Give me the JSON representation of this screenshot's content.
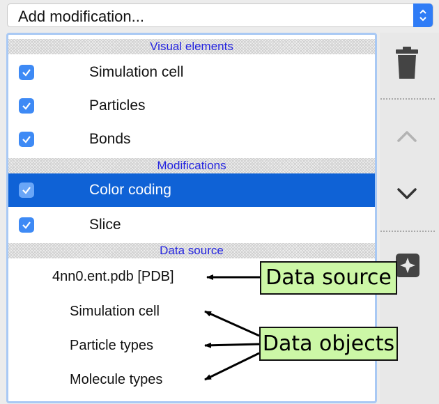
{
  "combo": {
    "value": "Add modification..."
  },
  "pipeline": {
    "sections": {
      "visual": "Visual elements",
      "modifications": "Modifications",
      "source": "Data source"
    },
    "visual_items": [
      {
        "label": "Simulation cell",
        "checked": true
      },
      {
        "label": "Particles",
        "checked": true
      },
      {
        "label": "Bonds",
        "checked": true
      }
    ],
    "modification_items": [
      {
        "label": "Color coding",
        "checked": true,
        "selected": true
      },
      {
        "label": "Slice",
        "checked": true,
        "selected": false
      }
    ],
    "source_items": [
      "4nn0.ent.pdb [PDB]",
      "Simulation cell",
      "Particle types",
      "Molecule types"
    ]
  },
  "toolbar": {
    "icons": [
      "trash-icon",
      "chevron-up-icon",
      "chevron-down-icon",
      "sparkle-icon"
    ]
  },
  "annotations": {
    "data_source": "Data source",
    "data_objects": "Data objects",
    "fill_color": "#ccf7a6"
  },
  "colors": {
    "selection": "#0f62d6",
    "checkbox": "#3e8af5",
    "section_text": "#2424e0",
    "focus_border": "#a9c9f4"
  }
}
